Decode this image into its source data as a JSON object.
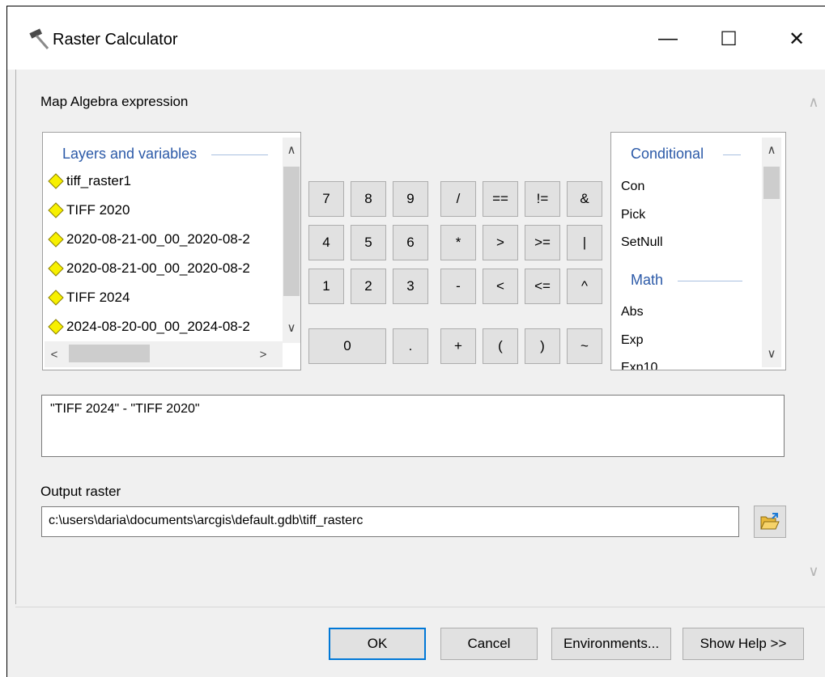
{
  "window": {
    "title": "Raster Calculator",
    "minimize_glyph": "—",
    "maximize_glyph": "☐",
    "close_glyph": "✕",
    "app_icon": "hammer-icon"
  },
  "expression_section": {
    "label": "Map Algebra expression"
  },
  "layers": {
    "header": "Layers and variables",
    "items": [
      "tiff_raster1",
      "TIFF 2020",
      "2020-08-21-00_00_2020-08-2",
      "2020-08-21-00_00_2020-08-2",
      "TIFF 2024",
      "2024-08-20-00_00_2024-08-2"
    ],
    "item_icon": "diamond-layer-icon",
    "item_icon_color": "#f7f000"
  },
  "keypad": {
    "digits": [
      [
        "7",
        "8",
        "9"
      ],
      [
        "4",
        "5",
        "6"
      ],
      [
        "1",
        "2",
        "3"
      ]
    ],
    "zero": "0",
    "dot": ".",
    "operators": [
      [
        "/",
        "==",
        "!=",
        "&"
      ],
      [
        "*",
        ">",
        ">=",
        "|"
      ],
      [
        "-",
        "<",
        "<=",
        "^"
      ],
      [
        "+",
        "(",
        ")",
        "~"
      ]
    ]
  },
  "functions": {
    "groups": [
      {
        "header": "Conditional",
        "items": [
          "Con",
          "Pick",
          "SetNull"
        ]
      },
      {
        "header": "Math",
        "items": [
          "Abs",
          "Exp",
          "Exp10"
        ]
      }
    ]
  },
  "expression": {
    "value": "\"TIFF 2024\" - \"TIFF 2020\""
  },
  "output": {
    "label": "Output raster",
    "value": "c:\\users\\daria\\documents\\arcgis\\default.gdb\\tiff_rasterc",
    "browse_icon": "open-folder-icon"
  },
  "buttons": {
    "ok": "OK",
    "cancel": "Cancel",
    "environments": "Environments...",
    "help": "Show Help >>"
  },
  "colors": {
    "accent": "#0078d7",
    "header_text": "#2c5aa8",
    "dialog_bg": "#f0f0f0",
    "button_bg": "#e1e1e1"
  }
}
